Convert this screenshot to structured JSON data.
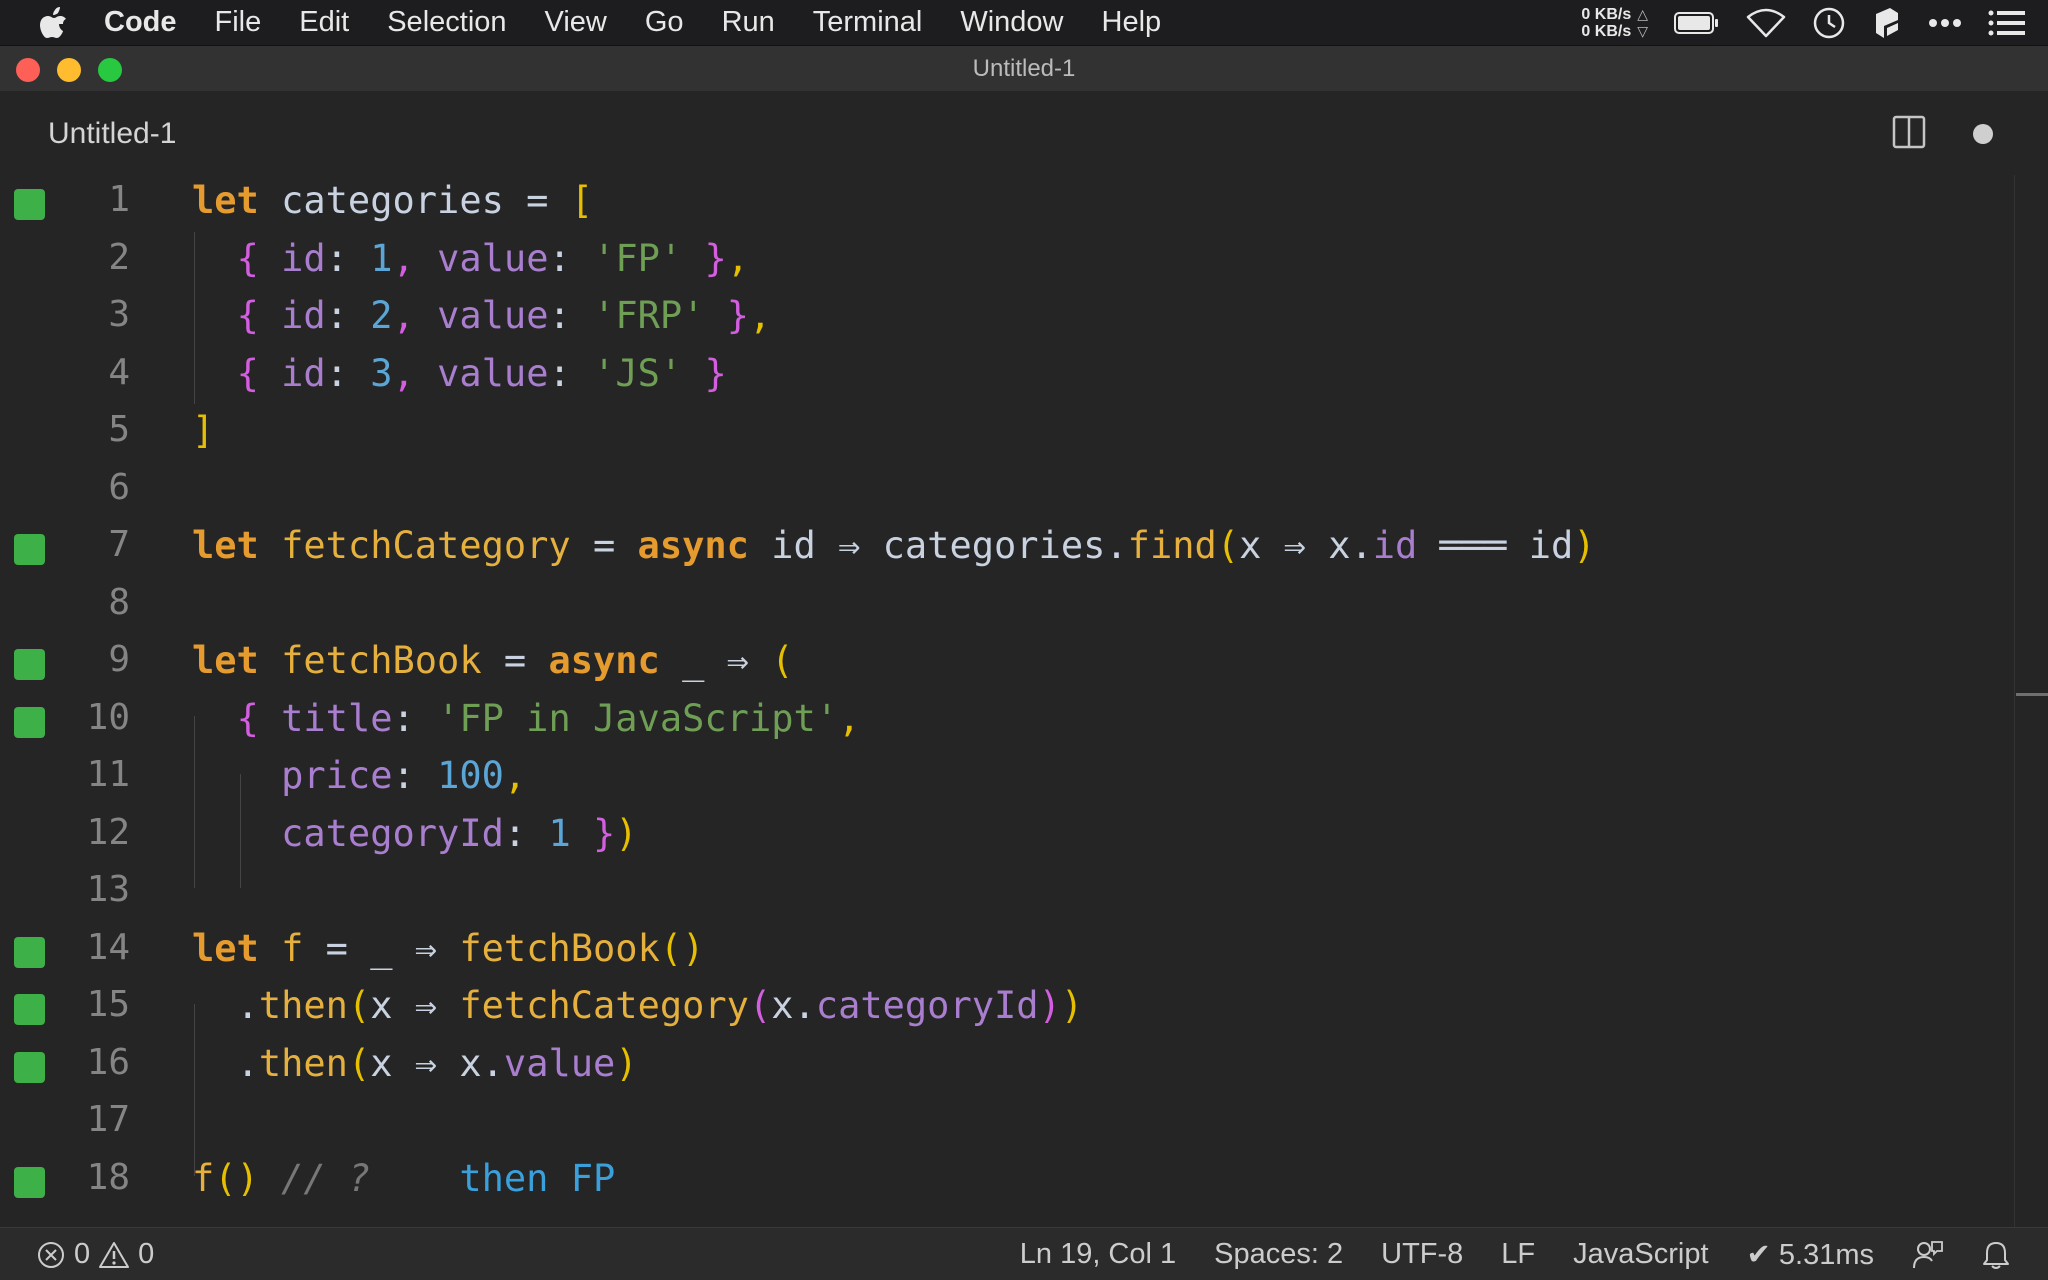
{
  "menubar": {
    "app_name": "Code",
    "items": [
      "File",
      "Edit",
      "Selection",
      "View",
      "Go",
      "Run",
      "Terminal",
      "Window",
      "Help"
    ],
    "net_up": "0 KB/s",
    "net_down": "0 KB/s",
    "net_up_arrow": "△",
    "net_down_arrow": "▽"
  },
  "window": {
    "title": "Untitled-1"
  },
  "tab": {
    "label": "Untitled-1"
  },
  "editor": {
    "lines": [
      {
        "num": "1",
        "modified": true
      },
      {
        "num": "2",
        "modified": false
      },
      {
        "num": "3",
        "modified": false
      },
      {
        "num": "4",
        "modified": false
      },
      {
        "num": "5",
        "modified": false
      },
      {
        "num": "6",
        "modified": false
      },
      {
        "num": "7",
        "modified": true
      },
      {
        "num": "8",
        "modified": false
      },
      {
        "num": "9",
        "modified": true
      },
      {
        "num": "10",
        "modified": true
      },
      {
        "num": "11",
        "modified": false
      },
      {
        "num": "12",
        "modified": false
      },
      {
        "num": "13",
        "modified": false
      },
      {
        "num": "14",
        "modified": true
      },
      {
        "num": "15",
        "modified": true
      },
      {
        "num": "16",
        "modified": true
      },
      {
        "num": "17",
        "modified": false
      },
      {
        "num": "18",
        "modified": true
      }
    ],
    "code": [
      [
        [
          "k",
          "let"
        ],
        [
          "t",
          " "
        ],
        [
          "v",
          "categories"
        ],
        [
          "t",
          " "
        ],
        [
          "o",
          "="
        ],
        [
          "t",
          " "
        ],
        [
          "d",
          "["
        ]
      ],
      [
        [
          "t",
          "  "
        ],
        [
          "m",
          "{"
        ],
        [
          "t",
          " "
        ],
        [
          "p",
          "id"
        ],
        [
          "o",
          ":"
        ],
        [
          "t",
          " "
        ],
        [
          "n",
          "1"
        ],
        [
          "m",
          ","
        ],
        [
          "t",
          " "
        ],
        [
          "p",
          "value"
        ],
        [
          "o",
          ":"
        ],
        [
          "t",
          " "
        ],
        [
          "s",
          "'FP'"
        ],
        [
          "t",
          " "
        ],
        [
          "m",
          "}"
        ],
        [
          "d",
          ","
        ]
      ],
      [
        [
          "t",
          "  "
        ],
        [
          "m",
          "{"
        ],
        [
          "t",
          " "
        ],
        [
          "p",
          "id"
        ],
        [
          "o",
          ":"
        ],
        [
          "t",
          " "
        ],
        [
          "n",
          "2"
        ],
        [
          "m",
          ","
        ],
        [
          "t",
          " "
        ],
        [
          "p",
          "value"
        ],
        [
          "o",
          ":"
        ],
        [
          "t",
          " "
        ],
        [
          "s",
          "'FRP'"
        ],
        [
          "t",
          " "
        ],
        [
          "m",
          "}"
        ],
        [
          "d",
          ","
        ]
      ],
      [
        [
          "t",
          "  "
        ],
        [
          "m",
          "{"
        ],
        [
          "t",
          " "
        ],
        [
          "p",
          "id"
        ],
        [
          "o",
          ":"
        ],
        [
          "t",
          " "
        ],
        [
          "n",
          "3"
        ],
        [
          "m",
          ","
        ],
        [
          "t",
          " "
        ],
        [
          "p",
          "value"
        ],
        [
          "o",
          ":"
        ],
        [
          "t",
          " "
        ],
        [
          "s",
          "'JS'"
        ],
        [
          "t",
          " "
        ],
        [
          "m",
          "}"
        ]
      ],
      [
        [
          "d",
          "]"
        ]
      ],
      [],
      [
        [
          "k",
          "let"
        ],
        [
          "t",
          " "
        ],
        [
          "f",
          "fetchCategory"
        ],
        [
          "t",
          " "
        ],
        [
          "o",
          "="
        ],
        [
          "t",
          " "
        ],
        [
          "k",
          "async"
        ],
        [
          "t",
          " "
        ],
        [
          "v",
          "id"
        ],
        [
          "t",
          " "
        ],
        [
          "o",
          "⇒"
        ],
        [
          "t",
          " "
        ],
        [
          "v",
          "categories"
        ],
        [
          "o",
          "."
        ],
        [
          "f",
          "find"
        ],
        [
          "d",
          "("
        ],
        [
          "v",
          "x"
        ],
        [
          "t",
          " "
        ],
        [
          "o",
          "⇒"
        ],
        [
          "t",
          " "
        ],
        [
          "v",
          "x"
        ],
        [
          "o",
          "."
        ],
        [
          "p",
          "id"
        ],
        [
          "t",
          " "
        ],
        [
          "o",
          "═══"
        ],
        [
          "t",
          " "
        ],
        [
          "v",
          "id"
        ],
        [
          "d",
          ")"
        ]
      ],
      [],
      [
        [
          "k",
          "let"
        ],
        [
          "t",
          " "
        ],
        [
          "f",
          "fetchBook"
        ],
        [
          "t",
          " "
        ],
        [
          "o",
          "="
        ],
        [
          "t",
          " "
        ],
        [
          "k",
          "async"
        ],
        [
          "t",
          " "
        ],
        [
          "v",
          "_"
        ],
        [
          "t",
          " "
        ],
        [
          "o",
          "⇒"
        ],
        [
          "t",
          " "
        ],
        [
          "d",
          "("
        ]
      ],
      [
        [
          "t",
          "  "
        ],
        [
          "m",
          "{"
        ],
        [
          "t",
          " "
        ],
        [
          "p",
          "title"
        ],
        [
          "o",
          ":"
        ],
        [
          "t",
          " "
        ],
        [
          "s",
          "'FP in JavaScript'"
        ],
        [
          "d",
          ","
        ]
      ],
      [
        [
          "t",
          "    "
        ],
        [
          "p",
          "price"
        ],
        [
          "o",
          ":"
        ],
        [
          "t",
          " "
        ],
        [
          "n",
          "100"
        ],
        [
          "d",
          ","
        ]
      ],
      [
        [
          "t",
          "    "
        ],
        [
          "p",
          "categoryId"
        ],
        [
          "o",
          ":"
        ],
        [
          "t",
          " "
        ],
        [
          "n",
          "1"
        ],
        [
          "t",
          " "
        ],
        [
          "m",
          "}"
        ],
        [
          "d",
          ")"
        ]
      ],
      [],
      [
        [
          "k",
          "let"
        ],
        [
          "t",
          " "
        ],
        [
          "f",
          "f"
        ],
        [
          "t",
          " "
        ],
        [
          "o",
          "="
        ],
        [
          "t",
          " "
        ],
        [
          "v",
          "_"
        ],
        [
          "t",
          " "
        ],
        [
          "o",
          "⇒"
        ],
        [
          "t",
          " "
        ],
        [
          "f",
          "fetchBook"
        ],
        [
          "d",
          "()"
        ]
      ],
      [
        [
          "t",
          "  "
        ],
        [
          "o",
          "."
        ],
        [
          "f",
          "then"
        ],
        [
          "d",
          "("
        ],
        [
          "v",
          "x"
        ],
        [
          "t",
          " "
        ],
        [
          "o",
          "⇒"
        ],
        [
          "t",
          " "
        ],
        [
          "f",
          "fetchCategory"
        ],
        [
          "m",
          "("
        ],
        [
          "v",
          "x"
        ],
        [
          "o",
          "."
        ],
        [
          "p",
          "categoryId"
        ],
        [
          "m",
          ")"
        ],
        [
          "d",
          ")"
        ]
      ],
      [
        [
          "t",
          "  "
        ],
        [
          "o",
          "."
        ],
        [
          "f",
          "then"
        ],
        [
          "d",
          "("
        ],
        [
          "v",
          "x"
        ],
        [
          "t",
          " "
        ],
        [
          "o",
          "⇒"
        ],
        [
          "t",
          " "
        ],
        [
          "v",
          "x"
        ],
        [
          "o",
          "."
        ],
        [
          "p",
          "value"
        ],
        [
          "d",
          ")"
        ]
      ],
      [],
      [
        [
          "f",
          "f"
        ],
        [
          "d",
          "()"
        ],
        [
          "t",
          " "
        ],
        [
          "c",
          "// ?"
        ],
        [
          "t",
          "    "
        ],
        [
          "h",
          "then FP"
        ]
      ]
    ]
  },
  "status": {
    "errors": "0",
    "warnings": "0",
    "cursor": "Ln 19, Col 1",
    "spaces": "Spaces: 2",
    "encoding": "UTF-8",
    "eol": "LF",
    "language": "JavaScript",
    "timing": "✔ 5.31ms"
  }
}
